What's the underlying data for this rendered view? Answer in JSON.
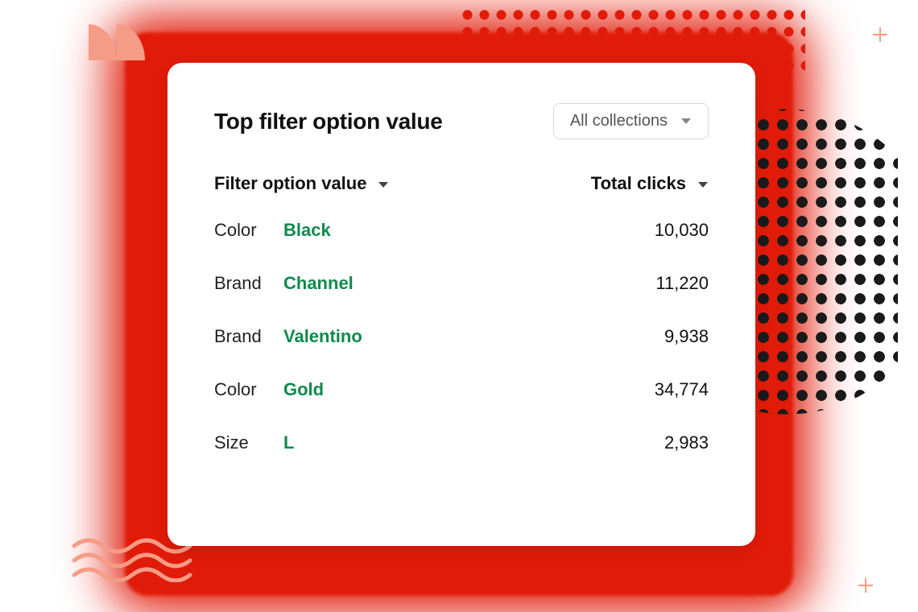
{
  "accent_green": "#0f8a4b",
  "accent_red": "#e11b09",
  "card": {
    "title": "Top filter option value",
    "dropdown": {
      "label": "All collections"
    },
    "columns": {
      "option": "Filter option value",
      "clicks": "Total clicks"
    },
    "rows": [
      {
        "category": "Color",
        "value": "Black",
        "clicks": "10,030"
      },
      {
        "category": "Brand",
        "value": "Channel",
        "clicks": "11,220"
      },
      {
        "category": "Brand",
        "value": "Valentino",
        "clicks": "9,938"
      },
      {
        "category": "Color",
        "value": "Gold",
        "clicks": "34,774"
      },
      {
        "category": "Size",
        "value": "L",
        "clicks": "2,983"
      }
    ]
  }
}
